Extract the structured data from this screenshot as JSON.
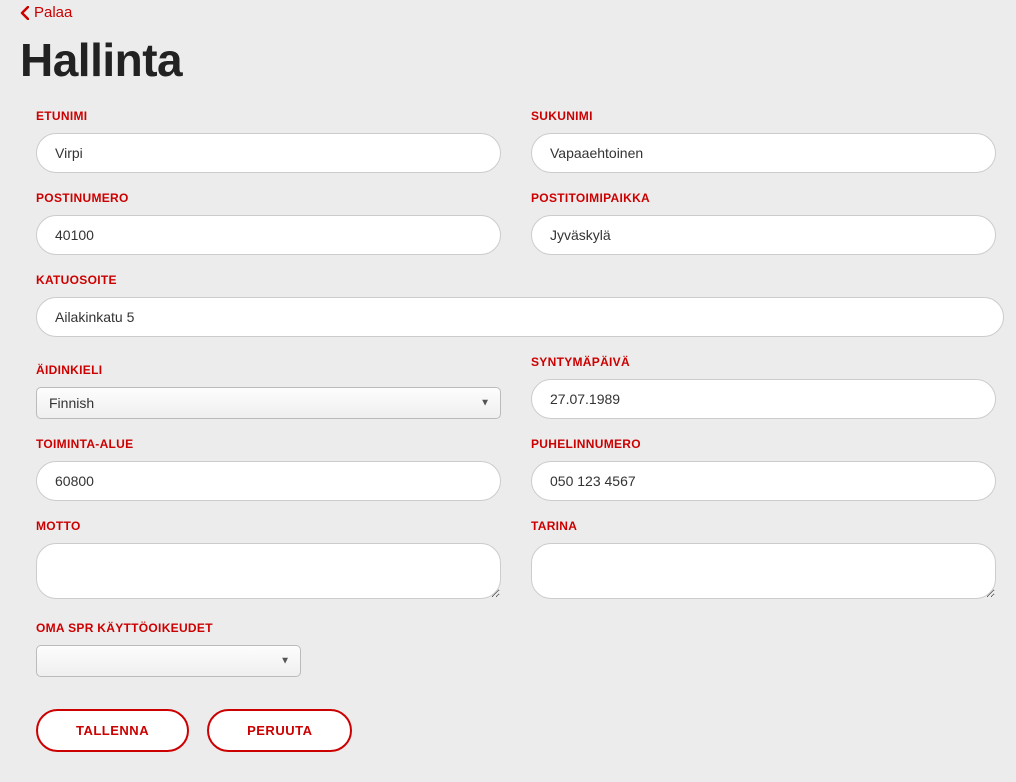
{
  "back": {
    "label": "Palaa"
  },
  "title": "Hallinta",
  "fields": {
    "etunimi": {
      "label": "ETUNIMI",
      "value": "Virpi"
    },
    "sukunimi": {
      "label": "SUKUNIMI",
      "value": "Vapaaehtoinen"
    },
    "postinumero": {
      "label": "POSTINUMERO",
      "value": "40100"
    },
    "postitoimi": {
      "label": "POSTITOIMIPAIKKA",
      "value": "Jyväskylä"
    },
    "katuosoite": {
      "label": "KATUOSOITE",
      "value": "Ailakinkatu 5"
    },
    "aidinkieli": {
      "label": "ÄIDINKIELI",
      "value": "Finnish"
    },
    "syntymapaiva": {
      "label": "SYNTYMÄPÄIVÄ",
      "value": "27.07.1989"
    },
    "toimintaalue": {
      "label": "TOIMINTA-ALUE",
      "value": "60800"
    },
    "puhelinnumero": {
      "label": "PUHELINNUMERO",
      "value": "050 123 4567"
    },
    "motto": {
      "label": "MOTTO",
      "value": ""
    },
    "tarina": {
      "label": "TARINA",
      "value": ""
    },
    "kayttooikeudet": {
      "label": "OMA SPR KÄYTTÖOIKEUDET",
      "value": ""
    }
  },
  "buttons": {
    "save": "TALLENNA",
    "cancel": "PERUUTA"
  }
}
